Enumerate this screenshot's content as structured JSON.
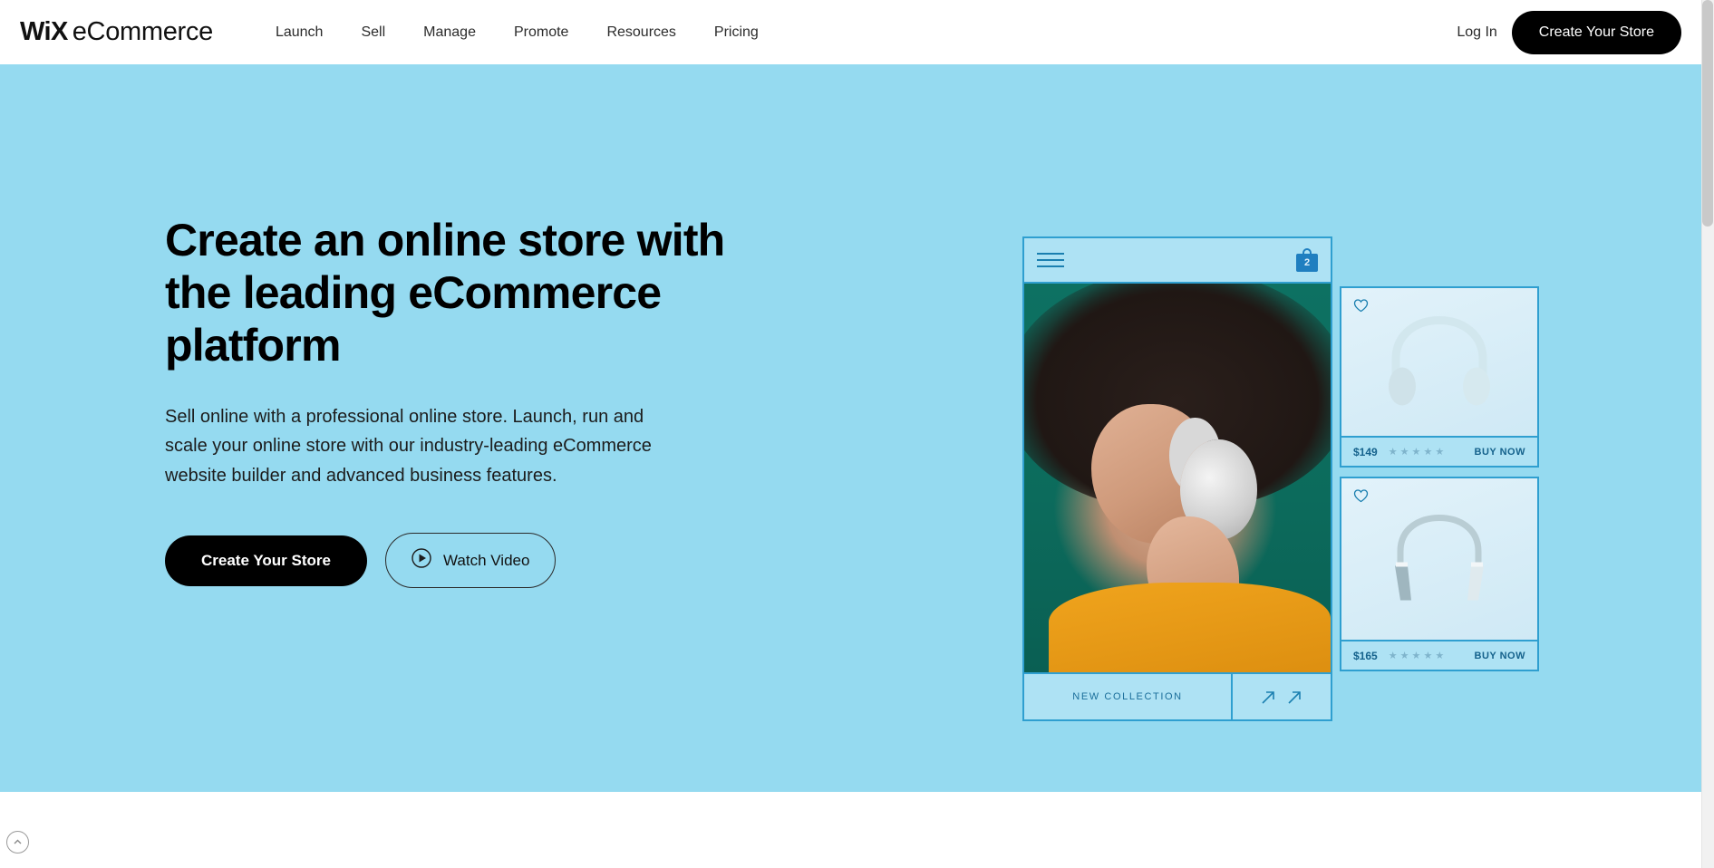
{
  "header": {
    "logo_mark": "WiX",
    "logo_word": "eCommerce",
    "nav": [
      {
        "label": "Launch"
      },
      {
        "label": "Sell"
      },
      {
        "label": "Manage"
      },
      {
        "label": "Promote"
      },
      {
        "label": "Resources"
      },
      {
        "label": "Pricing"
      }
    ],
    "login_label": "Log In",
    "cta_label": "Create Your Store"
  },
  "hero": {
    "title": "Create an online store with the leading eCommerce platform",
    "subtitle": "Sell online with a professional online store. Launch, run and scale your online store with our industry-leading eCommerce website builder and advanced business features.",
    "primary_cta": "Create Your Store",
    "secondary_cta": "Watch Video",
    "background_color": "#95daf0"
  },
  "mockup": {
    "menu_icon": "hamburger-icon",
    "cart_icon": "shopping-bag-icon",
    "cart_count": "2",
    "collection_label": "NEW COLLECTION",
    "arrows_icon": "diagonal-arrows-icon",
    "photo_background_color": "#0c6b5c",
    "accent_color": "#2f9fd0",
    "products": [
      {
        "favorite_icon": "heart-icon",
        "price": "$149",
        "stars": "★ ★ ★ ★ ★",
        "buy_label": "BUY NOW"
      },
      {
        "favorite_icon": "heart-icon",
        "price": "$165",
        "stars": "★ ★ ★ ★ ★",
        "buy_label": "BUY NOW"
      }
    ]
  },
  "footer": {
    "scroll_top_icon": "chevron-up-icon"
  }
}
